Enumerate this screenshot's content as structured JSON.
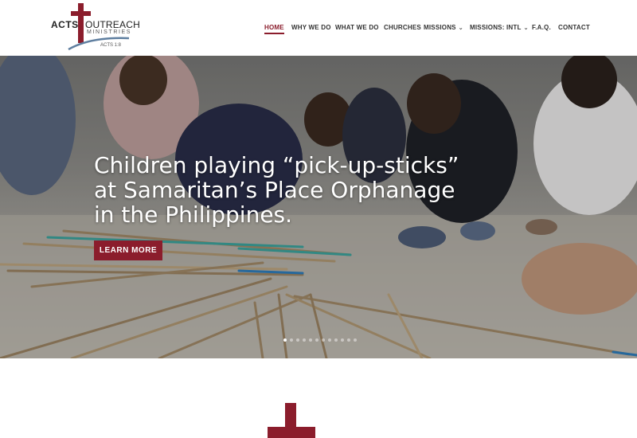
{
  "brand": {
    "name_left": "ACTS",
    "name_right": "OUTREACH",
    "subname": "MINISTRIES",
    "reference": "ACTS 1:8",
    "accent_color": "#8b1d2c"
  },
  "nav": {
    "items": [
      {
        "label": "HOME",
        "active": true,
        "dropdown": false
      },
      {
        "label": "WHY WE DO",
        "active": false,
        "dropdown": false
      },
      {
        "label": "WHAT WE DO",
        "active": false,
        "dropdown": false
      },
      {
        "label": "CHURCHES",
        "active": false,
        "dropdown": false
      },
      {
        "label": "MISSIONS",
        "active": false,
        "dropdown": true
      },
      {
        "label": "MISSIONS: INTL",
        "active": false,
        "dropdown": true
      },
      {
        "label": "F.A.Q.",
        "active": false,
        "dropdown": false
      },
      {
        "label": "CONTACT",
        "active": false,
        "dropdown": false
      }
    ],
    "chevron_icon": "chevron-down-icon"
  },
  "hero": {
    "title": "Children playing “pick-up-sticks” at Samaritan’s Place Orphanage in the Philippines.",
    "button_label": "LEARN MORE",
    "slide_count": 12,
    "active_slide": 1
  }
}
